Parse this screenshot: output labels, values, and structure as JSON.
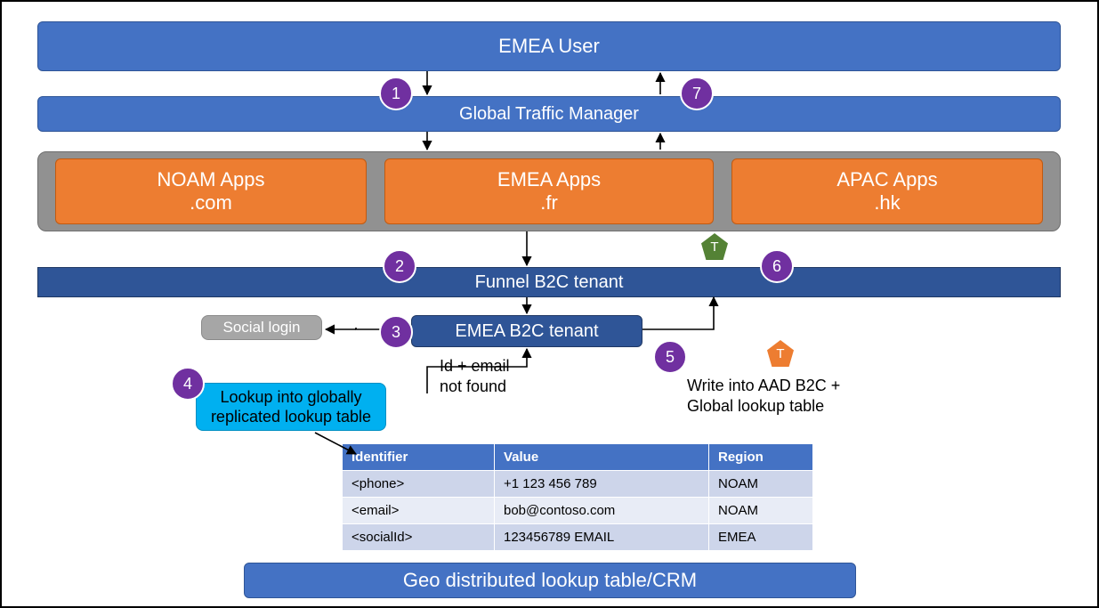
{
  "boxes": {
    "user": "EMEA User",
    "gtm": "Global Traffic Manager",
    "noam": "NOAM Apps\n.com",
    "emea": "EMEA Apps\n.fr",
    "apac": "APAC Apps\n.hk",
    "funnel": "Funnel B2C tenant",
    "tenant": "EMEA B2C tenant",
    "social": "Social login",
    "lookup": "Lookup into globally\nreplicated lookup table",
    "footer": "Geo distributed lookup table/CRM"
  },
  "labels": {
    "notfound": "Id + email\nnot found",
    "write": "Write into AAD B2C +\nGlobal lookup table"
  },
  "steps": {
    "s1": "1",
    "s2": "2",
    "s3": "3",
    "s4": "4",
    "s5": "5",
    "s6": "6",
    "s7": "7"
  },
  "pent": {
    "green": "T",
    "orange": "T"
  },
  "table": {
    "head": [
      "Identifier",
      "Value",
      "Region"
    ],
    "rows": [
      [
        "<phone>",
        "+1 123 456 789",
        "NOAM"
      ],
      [
        "<email>",
        "bob@contoso.com",
        "NOAM"
      ],
      [
        "<socialId>",
        "123456789 EMAIL",
        "EMEA"
      ]
    ]
  }
}
